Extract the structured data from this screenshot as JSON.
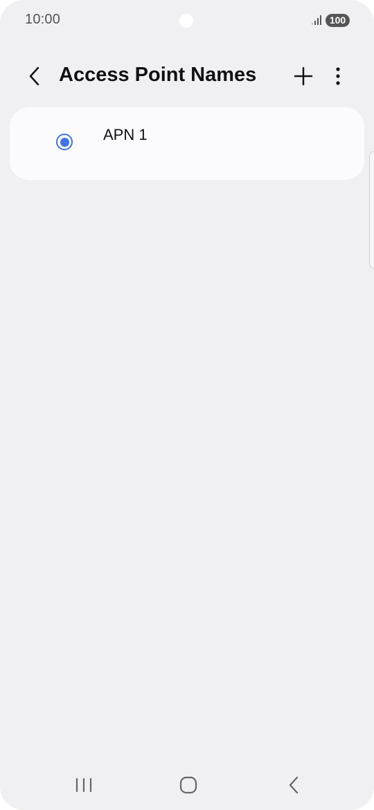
{
  "status_bar": {
    "time": "10:00",
    "battery_level": "100",
    "signal_icon": "signal-bars-icon"
  },
  "app_bar": {
    "title": "Access Point Names",
    "back_icon": "chevron-left-icon",
    "add_icon": "plus-icon",
    "more_icon": "more-vertical-icon"
  },
  "apn_list": [
    {
      "name": "APN 1",
      "selected": true
    }
  ],
  "colors": {
    "accent": "#3e74e6",
    "background": "#f0f0f2",
    "card": "#fbfbfe",
    "text": "#111111"
  },
  "nav_bar": {
    "recents_icon": "recents-icon",
    "home_icon": "home-icon",
    "back_icon": "back-icon"
  }
}
